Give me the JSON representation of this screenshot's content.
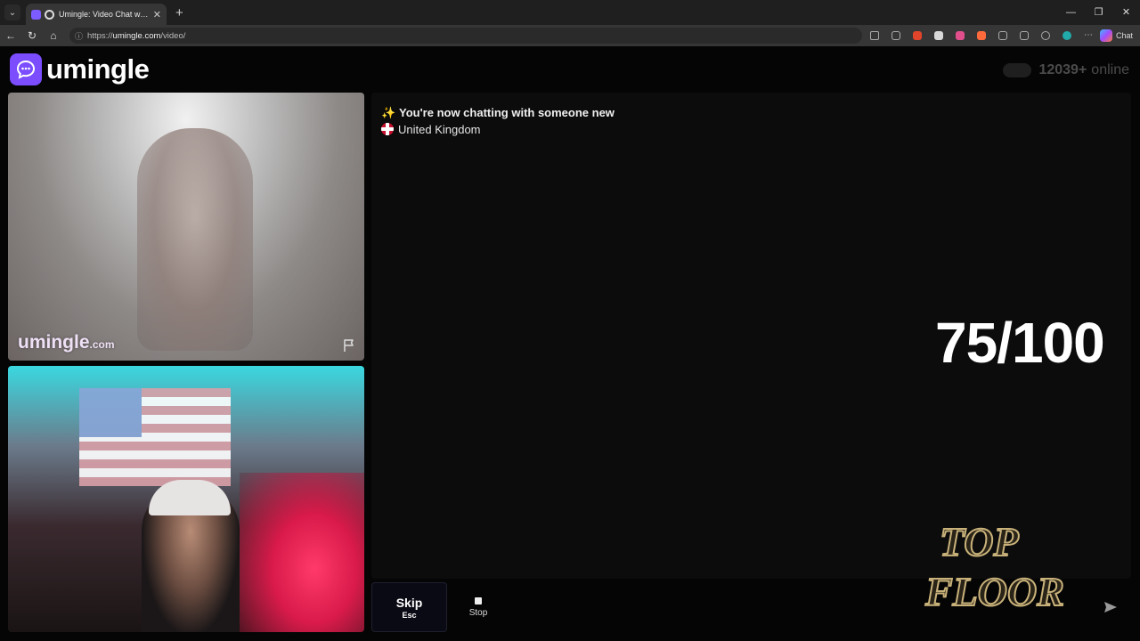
{
  "browser": {
    "tab_title": "Umingle: Video Chat with Str",
    "url_prefix": "https://",
    "url_host": "umingle.com",
    "url_path": "/video/",
    "chat_label": "Chat",
    "window_controls": [
      "minimize",
      "restore",
      "close"
    ]
  },
  "header": {
    "logo_text": "umingle",
    "online_count": "12039+",
    "online_label": "online"
  },
  "stranger_video": {
    "watermark": "umingle",
    "watermark_domain": ".com"
  },
  "chat": {
    "status_emoji": "✨",
    "status_message": "You're now chatting with someone new",
    "country": "United Kingdom"
  },
  "overlay": {
    "score": "75/100",
    "brand_line1": "TOP",
    "brand_line2": "FLOOR"
  },
  "controls": {
    "skip_label": "Skip",
    "skip_shortcut": "Esc",
    "stop_label": "Stop",
    "message_placeholder": ""
  },
  "colors": {
    "accent": "#7b4dff",
    "background": "#050505",
    "panel": "#0c0c0c"
  }
}
